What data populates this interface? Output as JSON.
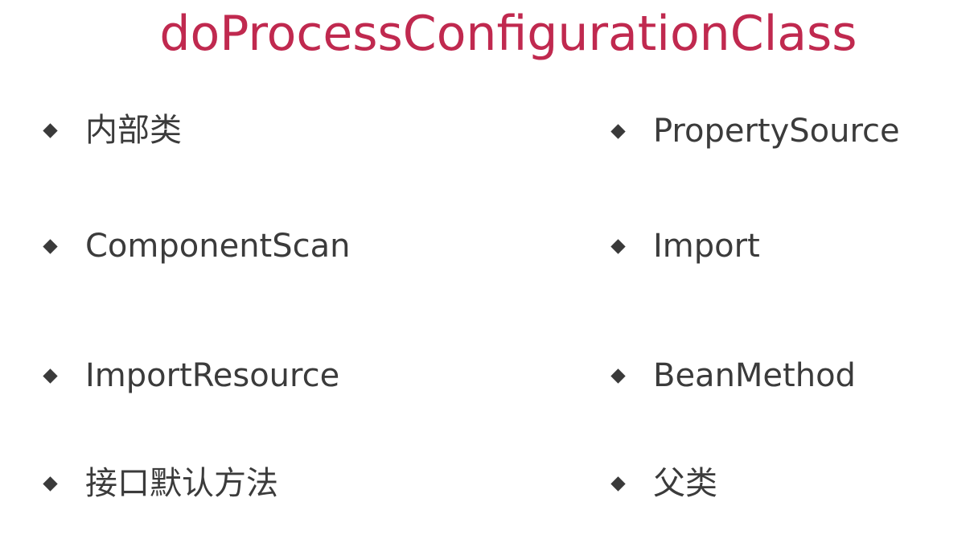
{
  "title": "doProcessConfigurationClass",
  "colors": {
    "title": "#c0294f",
    "text": "#3b3b3b",
    "bullet": "#3a3a3a",
    "background": "#ffffff"
  },
  "bullet_icon": "diamond-bullet-icon",
  "left_items": [
    {
      "label": "内部类"
    },
    {
      "label": "ComponentScan"
    },
    {
      "label": "ImportResource"
    },
    {
      "label": "接口默认方法"
    }
  ],
  "right_items": [
    {
      "label": "PropertySource"
    },
    {
      "label": "Import"
    },
    {
      "label": "BeanMethod"
    },
    {
      "label": "父类"
    }
  ]
}
